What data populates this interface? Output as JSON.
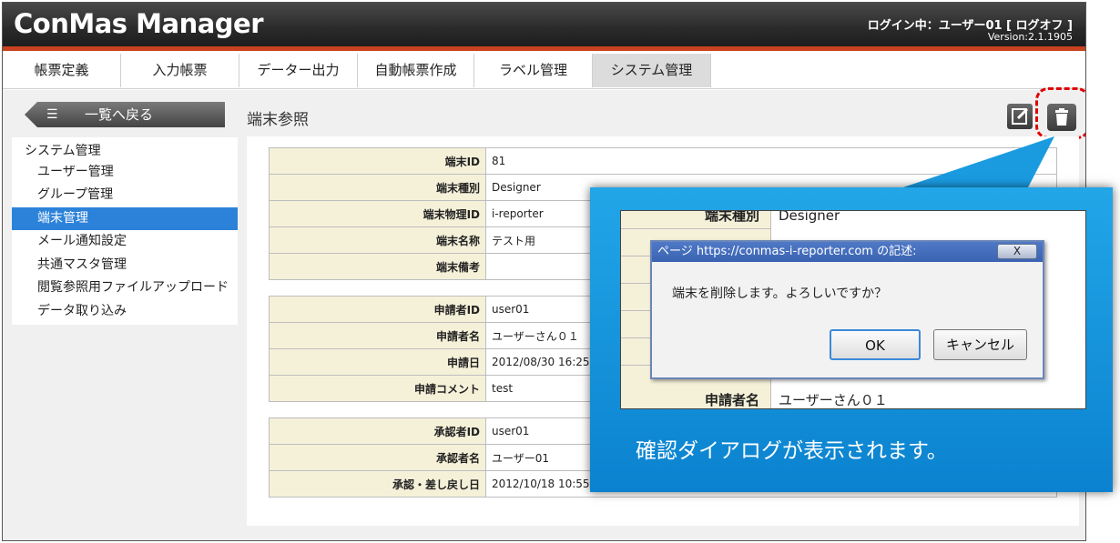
{
  "app": {
    "logo": "ConMas Manager",
    "login_text": "ログイン中：ユーザー01 [ ログオフ ]",
    "version": "Version:2.1.1905"
  },
  "menu": [
    {
      "label": "帳票定義"
    },
    {
      "label": "入力帳票"
    },
    {
      "label": "データー出力"
    },
    {
      "label": "自動帳票作成"
    },
    {
      "label": "ラベル管理"
    },
    {
      "label": "システム管理"
    }
  ],
  "toolbar": {
    "back_label": "一覧へ戻る",
    "page_title": "端末参照"
  },
  "sidebar": {
    "heading": "システム管理",
    "items": [
      {
        "label": "ユーザー管理"
      },
      {
        "label": "グループ管理"
      },
      {
        "label": "端末管理"
      },
      {
        "label": "メール通知設定"
      },
      {
        "label": "共通マスタ管理"
      },
      {
        "label": "閲覧参照用ファイルアップロード"
      },
      {
        "label": "データ取り込み"
      }
    ]
  },
  "terminal": [
    {
      "key": "端末ID",
      "value": "81"
    },
    {
      "key": "端末種別",
      "value": "Designer"
    },
    {
      "key": "端末物理ID",
      "value": "i-reporter"
    },
    {
      "key": "端末名称",
      "value": "テスト用"
    },
    {
      "key": "端末備考",
      "value": ""
    }
  ],
  "applicant": [
    {
      "key": "申請者ID",
      "value": "user01"
    },
    {
      "key": "申請者名",
      "value": "ユーザーさん０１"
    },
    {
      "key": "申請日",
      "value": "2012/08/30 16:25"
    },
    {
      "key": "申請コメント",
      "value": "test"
    }
  ],
  "approver": [
    {
      "key": "承認者ID",
      "value": "user01"
    },
    {
      "key": "承認者名",
      "value": "ユーザー01"
    },
    {
      "key": "承認・差し戻し日",
      "value": "2012/10/18 10:55"
    }
  ],
  "callout": {
    "zoom_top": {
      "key": "端末種別",
      "value": "Designer"
    },
    "zoom_bottom": {
      "key": "申請者名",
      "value": "ユーザーさん０１"
    },
    "dialog": {
      "title": "ページ https://conmas-i-reporter.com の記述:",
      "close": "X",
      "message": "端末を削除します。よろしいですか？",
      "ok": "OK",
      "cancel": "キャンセル"
    },
    "caption": "確認ダイアログが表示されます。"
  },
  "colors": {
    "accent_red": "#c8421e",
    "sidebar_active": "#2c82d9",
    "key_cell": "#f5f1d9",
    "callout_blue": "#0b82cf",
    "highlight_dash": "#e00000"
  }
}
